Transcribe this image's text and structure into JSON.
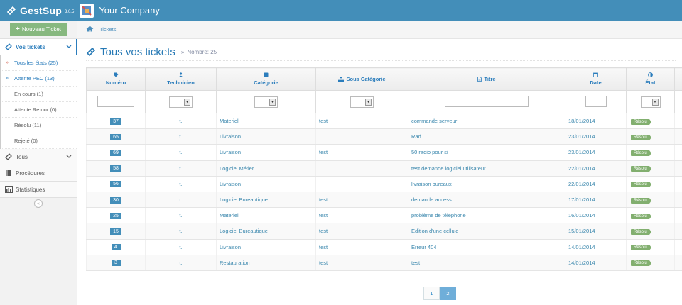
{
  "app": {
    "name": "GestSup",
    "version": "3.0.5",
    "company": "Your Company"
  },
  "sidebar": {
    "new_ticket_label": "Nouveau Ticket",
    "vos_tickets_label": "Vos tickets",
    "sub_items": [
      {
        "label": "Tous les états (25)",
        "current": true
      },
      {
        "label": "Attente PEC (13)",
        "current": false
      },
      {
        "label": "En cours (1)",
        "current": false
      },
      {
        "label": "Attente Retour (0)",
        "current": false
      },
      {
        "label": "Résolu (11)",
        "current": false
      },
      {
        "label": "Rejeté (0)",
        "current": false
      }
    ],
    "tous_label": "Tous",
    "procedures_label": "Procédures",
    "statistiques_label": "Statistiques"
  },
  "breadcrumb": {
    "label": "Tickets"
  },
  "header": {
    "title": "Tous vos tickets",
    "count_label": "Nombre: 25"
  },
  "table": {
    "columns": {
      "numero": "Numéro",
      "technicien": "Technicien",
      "categorie": "Catégorie",
      "sous_categorie": "Sous Catégorie",
      "titre": "Titre",
      "date": "Date",
      "etat": "État"
    },
    "rows": [
      {
        "num": "37",
        "tech": "t.",
        "cat": "Materiel",
        "subcat": "test",
        "title": "commande serveur",
        "date": "18/01/2014",
        "state": "Résolu"
      },
      {
        "num": "65",
        "tech": "t.",
        "cat": "Livraison",
        "subcat": "",
        "title": "Rad",
        "date": "23/01/2014",
        "state": "Résolu"
      },
      {
        "num": "69",
        "tech": "t.",
        "cat": "Livraison",
        "subcat": "test",
        "title": "50 radio pour si",
        "date": "23/01/2014",
        "state": "Résolu"
      },
      {
        "num": "58",
        "tech": "t.",
        "cat": "Logiciel Métier",
        "subcat": "",
        "title": "test demande logiciel utilisateur",
        "date": "22/01/2014",
        "state": "Résolu"
      },
      {
        "num": "56",
        "tech": "t.",
        "cat": "Livraison",
        "subcat": "",
        "title": "livraison bureaux",
        "date": "22/01/2014",
        "state": "Résolu"
      },
      {
        "num": "30",
        "tech": "t.",
        "cat": "Logiciel Bureautique",
        "subcat": "test",
        "title": "demande access",
        "date": "17/01/2014",
        "state": "Résolu"
      },
      {
        "num": "25",
        "tech": "t.",
        "cat": "Materiel",
        "subcat": "test",
        "title": "problème de téléphone",
        "date": "16/01/2014",
        "state": "Résolu"
      },
      {
        "num": "15",
        "tech": "t.",
        "cat": "Logiciel Bureautique",
        "subcat": "test",
        "title": "Edition d'une cellule",
        "date": "15/01/2014",
        "state": "Résolu"
      },
      {
        "num": "4",
        "tech": "t.",
        "cat": "Livraison",
        "subcat": "test",
        "title": "Erreur 404",
        "date": "14/01/2014",
        "state": "Résolu"
      },
      {
        "num": "3",
        "tech": "t.",
        "cat": "Restauration",
        "subcat": "test",
        "title": "test",
        "date": "14/01/2014",
        "state": "Résolu"
      }
    ]
  },
  "pagination": {
    "pages": [
      "1",
      "2"
    ],
    "current": "2"
  },
  "colors": {
    "navbar": "#438eb9",
    "accent": "#2b7dbc",
    "new_ticket_button": "#87b87f",
    "resolved_badge": "#82af6f"
  },
  "icons": {
    "brand": "ticket-icon",
    "home": "home-icon",
    "tag": "tag-icon",
    "user": "user-icon",
    "square": "square-icon",
    "sitemap": "sitemap-icon",
    "file": "file-icon",
    "calendar": "calendar-icon",
    "adjust": "adjust-icon"
  }
}
